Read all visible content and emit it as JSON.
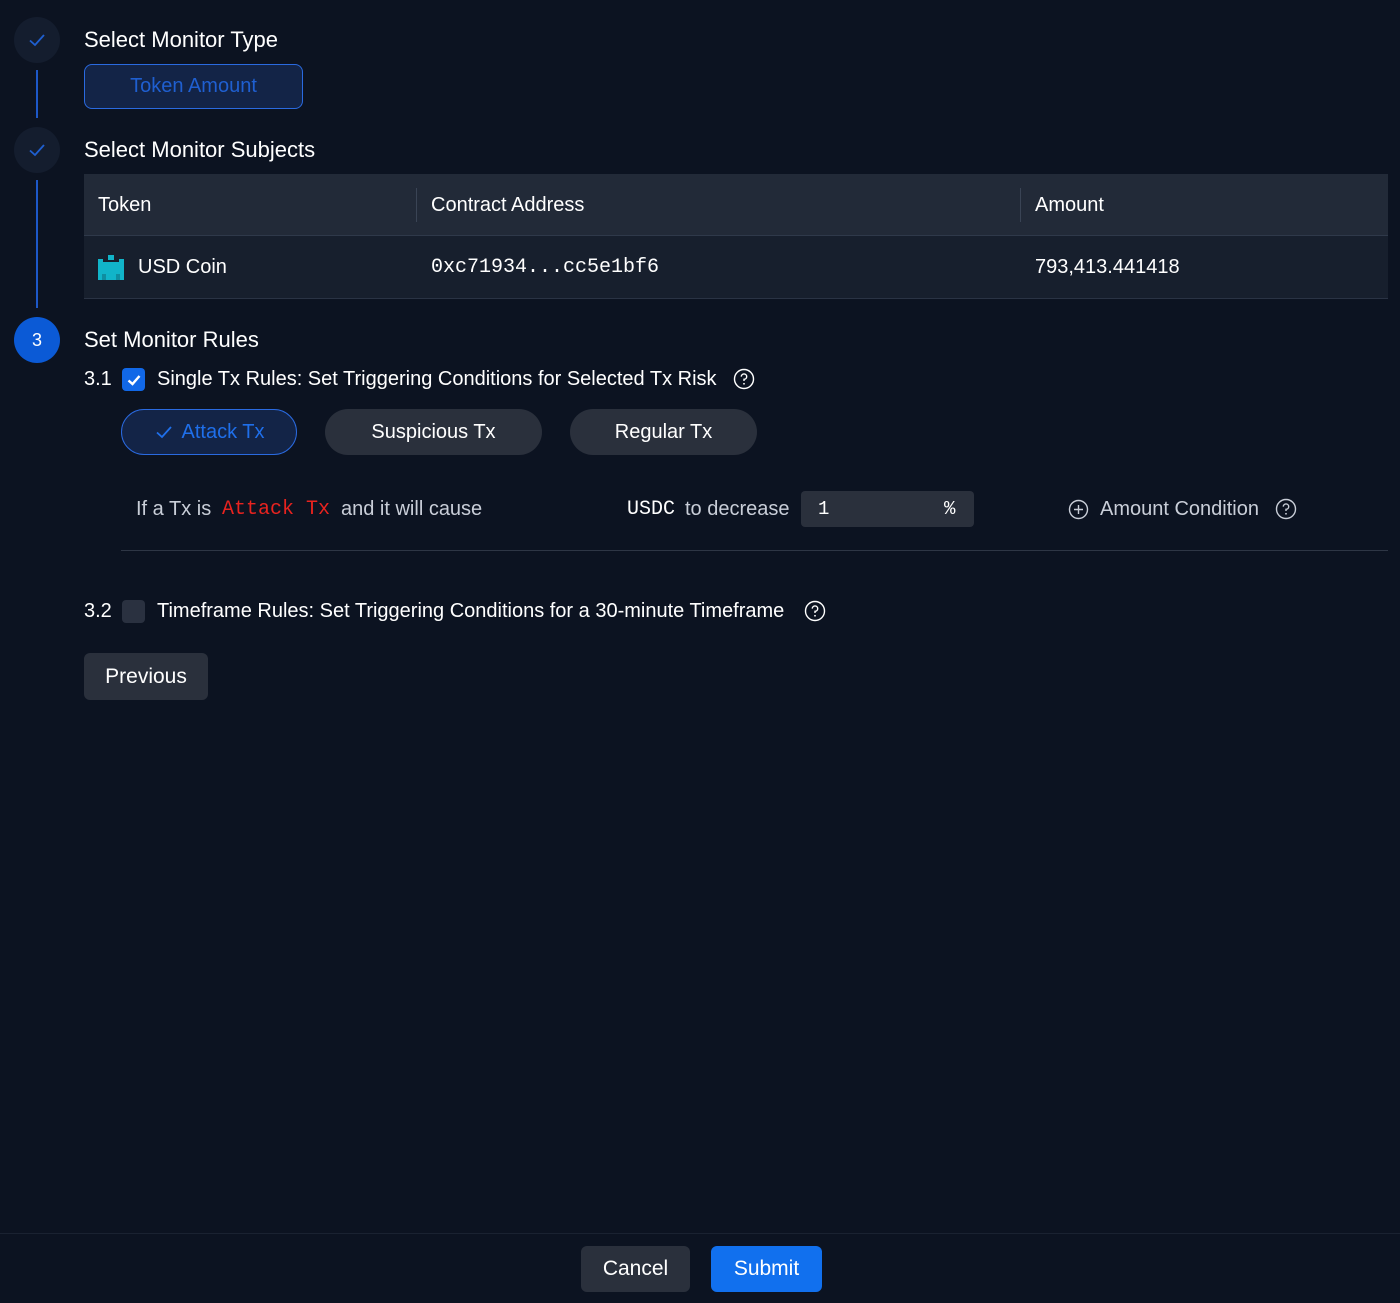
{
  "steps": [
    {
      "title": "Select Monitor Type",
      "state": "done"
    },
    {
      "title": "Select Monitor Subjects",
      "state": "done"
    },
    {
      "number": "3",
      "title": "Set Monitor Rules",
      "state": "active"
    }
  ],
  "monitor_type": {
    "selected_label": "Token Amount"
  },
  "subjects_table": {
    "headers": [
      "Token",
      "Contract Address",
      "Amount"
    ],
    "rows": [
      {
        "token": "USD Coin",
        "token_icon": "usdc-token-icon",
        "address": "0xc71934...cc5e1bf6",
        "amount": "793,413.441418"
      }
    ]
  },
  "rules": {
    "single_tx": {
      "number": "3.1",
      "checked": true,
      "label": "Single Tx Rules: Set Triggering Conditions for Selected Tx Risk",
      "risk_options": [
        {
          "label": "Attack Tx",
          "selected": true
        },
        {
          "label": "Suspicious Tx",
          "selected": false
        },
        {
          "label": "Regular Tx",
          "selected": false
        }
      ],
      "condition": {
        "prefix": "If a Tx is",
        "risk_word": "Attack Tx",
        "middle": "and it will cause",
        "token": "USDC",
        "action": "to decrease",
        "value": "1",
        "unit": "%",
        "add_label": "Amount Condition"
      }
    },
    "timeframe": {
      "number": "3.2",
      "checked": false,
      "label": "Timeframe Rules: Set Triggering Conditions for a 30-minute Timeframe"
    }
  },
  "buttons": {
    "previous": "Previous",
    "cancel": "Cancel",
    "submit": "Submit"
  },
  "colors": {
    "background": "#0c1321",
    "accent": "#1170ee",
    "attack": "#e8231f"
  }
}
